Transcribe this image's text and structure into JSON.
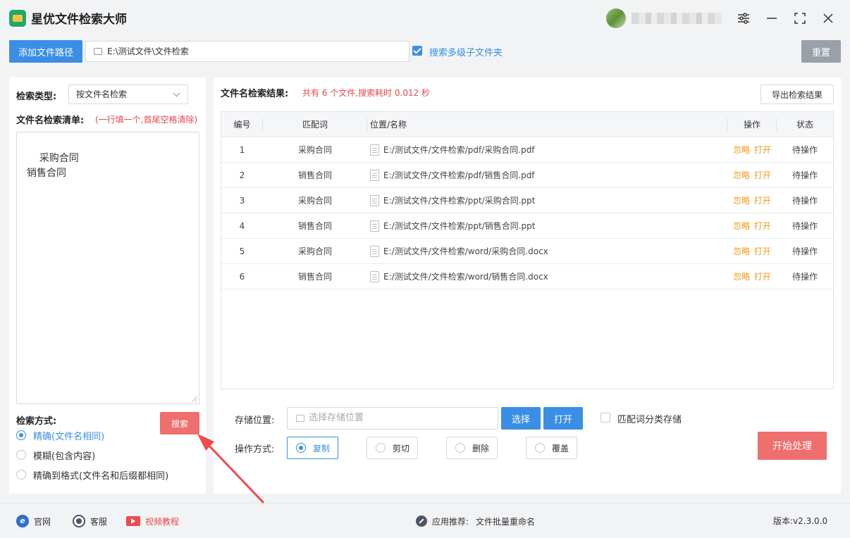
{
  "app": {
    "title": "星优文件检索大师"
  },
  "toolbar": {
    "add_path_label": "添加文件路径",
    "path_value": "E:\\测试文件\\文件检索",
    "search_subfolders_label": "搜索多级子文件夹",
    "search_subfolders_checked": true,
    "reset_label": "重置"
  },
  "left": {
    "search_type_label": "检索类型:",
    "search_type_value": "按文件名检索",
    "keyword_list_label": "文件名检索清单:",
    "keyword_list_hint": "(一行填一个,首尾空格清除)",
    "keywords_text": "采购合同\n销售合同",
    "search_mode_label": "检索方式:",
    "search_button": "搜索",
    "modes": [
      {
        "label": "精确(文件名相同)",
        "selected": true
      },
      {
        "label": "模糊(包含内容)",
        "selected": false
      },
      {
        "label": "精确到格式(文件名和后缀都相同)",
        "selected": false
      }
    ]
  },
  "results": {
    "title": "文件名检索结果:",
    "summary": "共有 6 个文件,搜索耗时 0.012 秒",
    "export_label": "导出检索结果",
    "columns": [
      "编号",
      "匹配词",
      "位置/名称",
      "操作",
      "状态"
    ],
    "action_ignore": "忽略",
    "action_open": "打开",
    "rows": [
      {
        "no": "1",
        "match": "采购合同",
        "path": "E:/测试文件/文件检索/pdf/采购合同.pdf",
        "status": "待操作"
      },
      {
        "no": "2",
        "match": "销售合同",
        "path": "E:/测试文件/文件检索/pdf/销售合同.pdf",
        "status": "待操作"
      },
      {
        "no": "3",
        "match": "采购合同",
        "path": "E:/测试文件/文件检索/ppt/采购合同.ppt",
        "status": "待操作"
      },
      {
        "no": "4",
        "match": "销售合同",
        "path": "E:/测试文件/文件检索/ppt/销售合同.ppt",
        "status": "待操作"
      },
      {
        "no": "5",
        "match": "采购合同",
        "path": "E:/测试文件/文件检索/word/采购合同.docx",
        "status": "待操作"
      },
      {
        "no": "6",
        "match": "销售合同",
        "path": "E:/测试文件/文件检索/word/销售合同.docx",
        "status": "待操作"
      }
    ]
  },
  "bottom": {
    "storage_label": "存储位置:",
    "storage_placeholder": "选择存储位置",
    "choose_label": "选择",
    "open_label": "打开",
    "classify_label": "匹配词分类存储",
    "classify_checked": false,
    "op_mode_label": "操作方式:",
    "op_modes": [
      {
        "label": "复制",
        "selected": true
      },
      {
        "label": "剪切",
        "selected": false
      },
      {
        "label": "删除",
        "selected": false
      },
      {
        "label": "覆盖",
        "selected": false
      }
    ],
    "start_label": "开始处理"
  },
  "statusbar": {
    "website": "官网",
    "support": "客服",
    "video": "视频教程",
    "recommend_prefix": "应用推荐:",
    "recommend_app": "文件批量重命名",
    "version": "版本:v2.3.0.0"
  },
  "colors": {
    "accent": "#3a8ee6",
    "danger": "#ef6e6e",
    "warning": "#f29b1c"
  }
}
